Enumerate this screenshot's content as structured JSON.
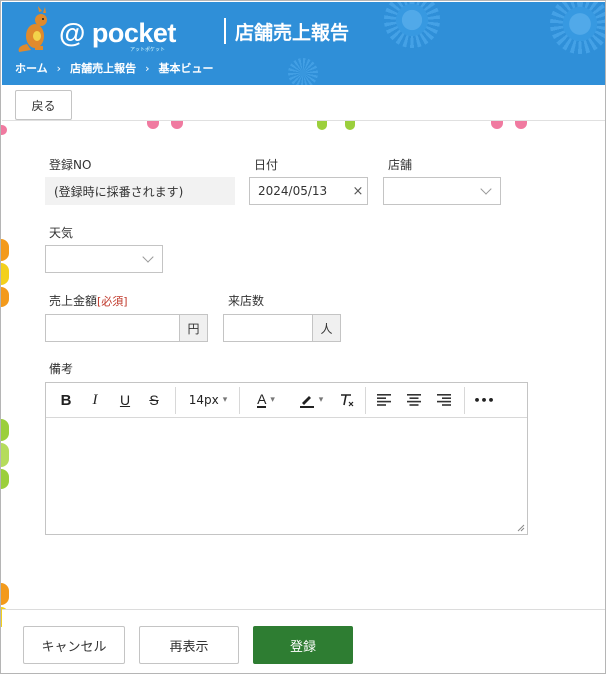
{
  "header": {
    "app_name": "@ pocket",
    "app_subtitle": "アットポケット",
    "page_title": "店舗売上報告",
    "breadcrumb": [
      "ホーム",
      "店舗売上報告",
      "基本ビュー"
    ],
    "breadcrumb_separator": "›"
  },
  "toolbar": {
    "back_label": "戻る"
  },
  "form": {
    "registration_no": {
      "label": "登録NO",
      "value": "(登録時に採番されます)"
    },
    "date": {
      "label": "日付",
      "value": "2024/05/13",
      "clear": "×"
    },
    "store": {
      "label": "店舗",
      "value": ""
    },
    "weather": {
      "label": "天気",
      "value": ""
    },
    "sales_amount": {
      "label": "売上金額",
      "required": "[必須]",
      "value": "",
      "unit": "円"
    },
    "visitors": {
      "label": "来店数",
      "value": "",
      "unit": "人"
    },
    "notes": {
      "label": "備考",
      "value": "",
      "toolbar": {
        "bold": "B",
        "italic": "I",
        "underline": "U",
        "strike": "S",
        "font_size": "14px",
        "text_color": "A",
        "more": "•••"
      }
    }
  },
  "footer": {
    "cancel_label": "キャンセル",
    "redisplay_label": "再表示",
    "register_label": "登録"
  },
  "colors": {
    "header_bg": "#2f8fd8",
    "primary_button": "#2e7d32",
    "required": "#c0392b"
  },
  "icons": [
    "kangaroo-logo-icon",
    "chevron-down-icon",
    "clear-icon",
    "highlight-pen-icon",
    "clear-format-icon",
    "align-left-icon",
    "align-center-icon",
    "align-right-icon",
    "more-icon"
  ]
}
